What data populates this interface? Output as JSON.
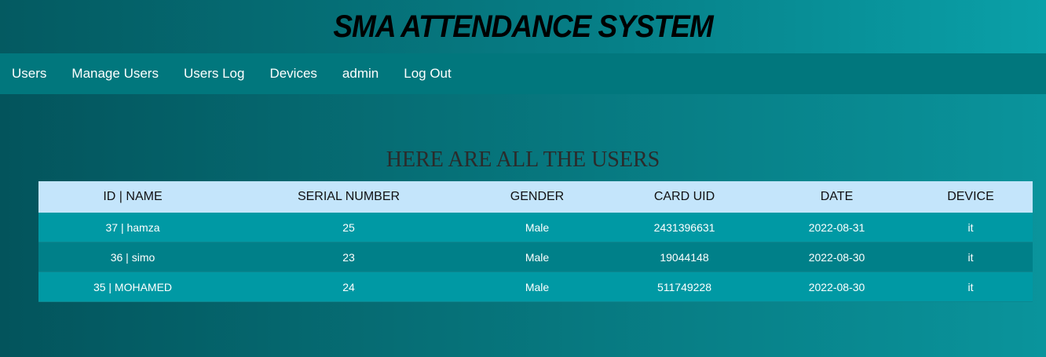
{
  "header": {
    "title": "SMA ATTENDANCE SYSTEM"
  },
  "nav": {
    "items": [
      {
        "label": "Users"
      },
      {
        "label": "Manage Users"
      },
      {
        "label": "Users Log"
      },
      {
        "label": "Devices"
      },
      {
        "label": "admin"
      },
      {
        "label": "Log Out"
      }
    ]
  },
  "main": {
    "title": "HERE ARE ALL THE USERS",
    "table": {
      "columns": [
        "ID | NAME",
        "SERIAL NUMBER",
        "GENDER",
        "CARD UID",
        "DATE",
        "DEVICE"
      ],
      "rows": [
        [
          "37 | hamza",
          "25",
          "Male",
          "2431396631",
          "2022-08-31",
          "it"
        ],
        [
          "36 | simo",
          "23",
          "Male",
          "19044148",
          "2022-08-30",
          "it"
        ],
        [
          "35 | MOHAMED",
          "24",
          "Male",
          "511749228",
          "2022-08-30",
          "it"
        ]
      ]
    }
  }
}
